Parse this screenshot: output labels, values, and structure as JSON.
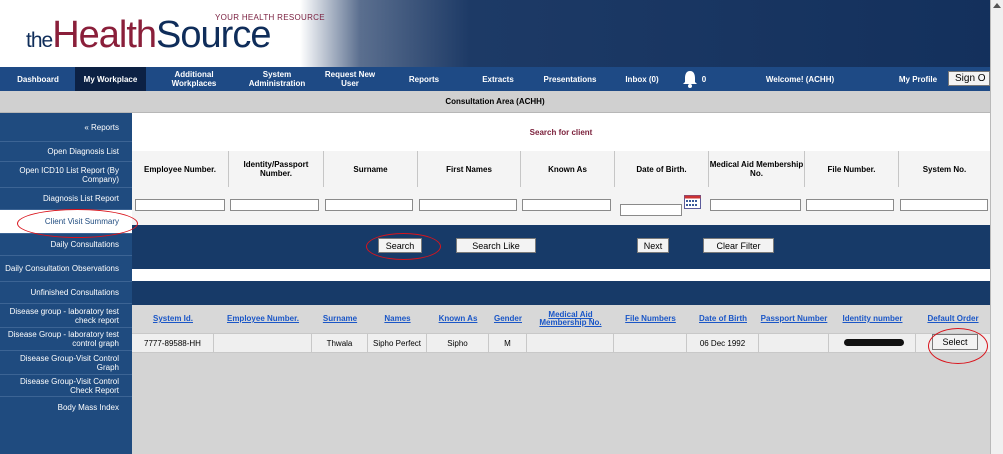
{
  "header": {
    "logo_the": "the",
    "logo_health": "Health",
    "logo_source": "Source",
    "tagline": "YOUR HEALTH RESOURCE"
  },
  "nav": {
    "items": [
      {
        "label": "Dashboard"
      },
      {
        "label": "My Workplace"
      },
      {
        "label": "Additional Workplaces"
      },
      {
        "label": "System Administration"
      },
      {
        "label": "Request New User"
      },
      {
        "label": "Reports"
      },
      {
        "label": "Extracts"
      },
      {
        "label": "Presentations"
      },
      {
        "label": "Inbox (0)"
      },
      {
        "label": "0"
      },
      {
        "label": "Welcome! (ACHH)"
      },
      {
        "label": "My Profile"
      }
    ],
    "sign_out": "Sign O"
  },
  "consultation_area": "Consultation Area (ACHH)",
  "sidebar": {
    "items": [
      {
        "label": "« Reports"
      },
      {
        "label": "Open Diagnosis List"
      },
      {
        "label": "Open ICD10 List Report (By Company)"
      },
      {
        "label": "Diagnosis List Report"
      },
      {
        "label": "Client Visit Summary"
      },
      {
        "label": "Daily Consultations"
      },
      {
        "label": "Daily Consultation Observations"
      },
      {
        "label": "Unfinished Consultations"
      },
      {
        "label": "Disease group - laboratory test check report"
      },
      {
        "label": "Disease Group - laboratory test control graph"
      },
      {
        "label": "Disease Group-Visit Control Graph"
      },
      {
        "label": "Disease Group-Visit Control Check Report"
      },
      {
        "label": "Body Mass Index"
      }
    ]
  },
  "search": {
    "title": "Search for client",
    "columns": [
      {
        "label": "Employee Number."
      },
      {
        "label": "Identity/Passport Number."
      },
      {
        "label": "Surname"
      },
      {
        "label": "First Names"
      },
      {
        "label": "Known As"
      },
      {
        "label": "Date of Birth."
      },
      {
        "label": "Medical Aid Membership No."
      },
      {
        "label": "File Number."
      },
      {
        "label": "System No."
      }
    ],
    "buttons": {
      "search": "Search",
      "search_like": "Search Like",
      "next": "Next",
      "clear_filter": "Clear Filter"
    }
  },
  "results": {
    "columns": [
      {
        "label": "System Id."
      },
      {
        "label": "Employee Number."
      },
      {
        "label": "Surname"
      },
      {
        "label": "Names"
      },
      {
        "label": "Known As"
      },
      {
        "label": "Gender"
      },
      {
        "label": "Medical Aid Membership No."
      },
      {
        "label": "File Numbers"
      },
      {
        "label": "Date of Birth"
      },
      {
        "label": "Passport Number"
      },
      {
        "label": "Identity number"
      },
      {
        "label": "Default Order"
      }
    ],
    "rows": [
      {
        "system_id": "7777-89588-HH",
        "employee_number": "",
        "surname": "Thwala",
        "names": "Sipho Perfect",
        "known_as": "Sipho",
        "gender": "M",
        "medical_aid": "",
        "file_numbers": "",
        "date_of_birth": "06 Dec 1992",
        "passport_number": "",
        "select_label": "Select"
      }
    ]
  },
  "colors": {
    "nav_blue": "#1e4a85",
    "sidebar_blue": "#1f4b7f",
    "action_band": "#173a68",
    "brand_maroon": "#8a1f3a",
    "link_blue": "#1a56c7",
    "annotation_red": "#d9141c"
  },
  "icons": {
    "bell": "bell-icon",
    "calendar": "calendar-icon"
  }
}
